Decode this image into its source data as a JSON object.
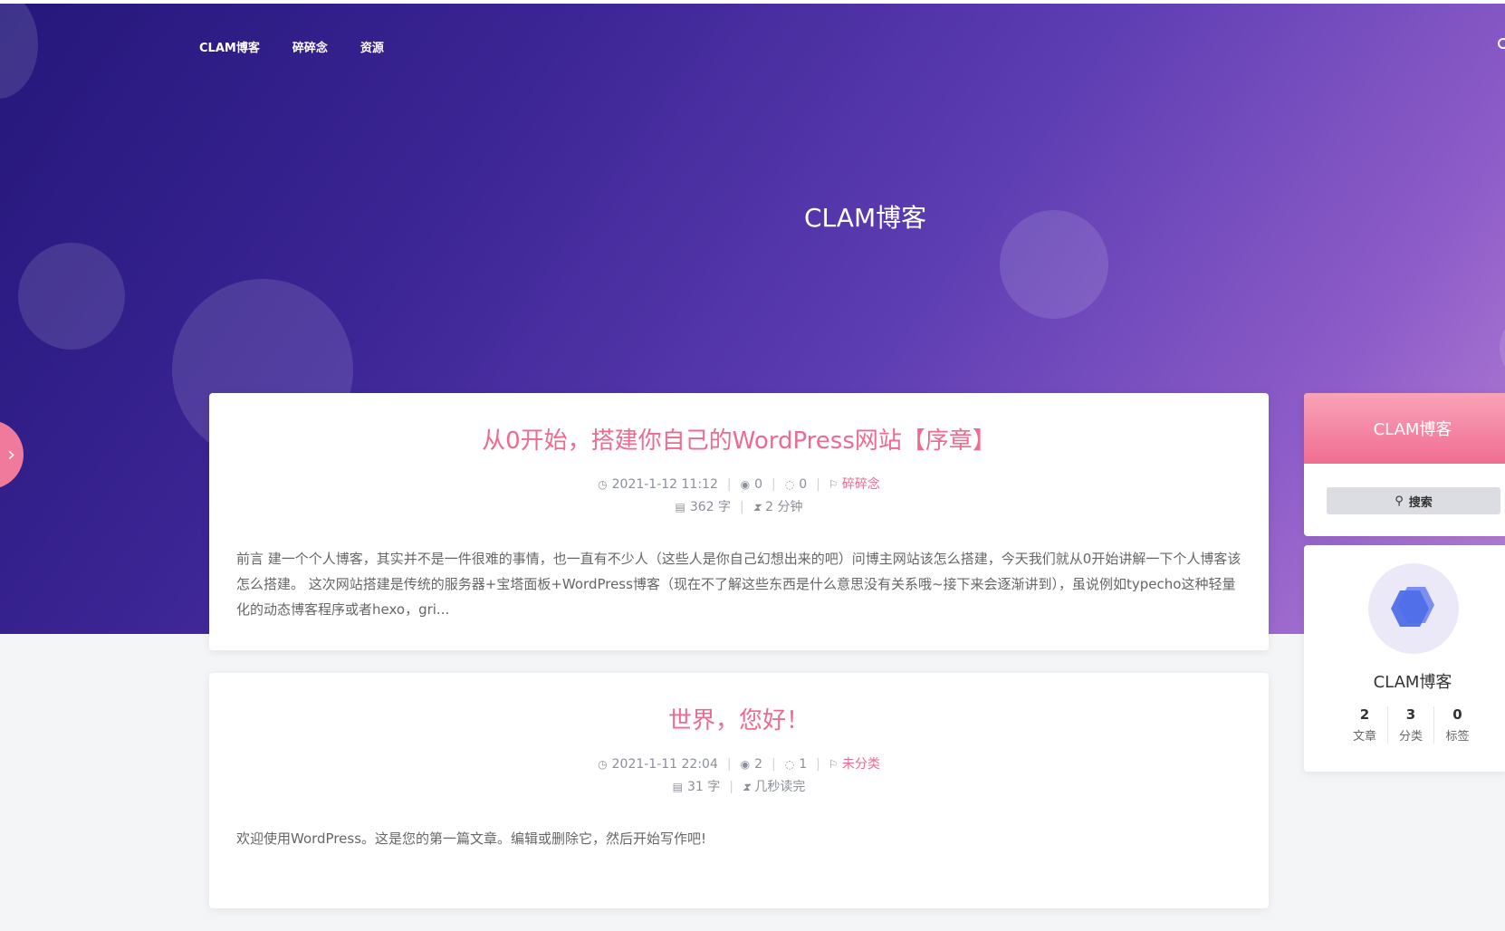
{
  "nav": {
    "items": [
      "CLAM博客",
      "碎碎念",
      "资源"
    ]
  },
  "hero": {
    "title": "CLAM博客"
  },
  "posts": [
    {
      "title": "从0开始，搭建你自己的WordPress网站【序章】",
      "date": "2021-1-12 11:12",
      "views": "0",
      "comments": "0",
      "category": "碎碎念",
      "words": "362 字",
      "read_time": "2 分钟",
      "excerpt": "前言 建一个个人博客，其实并不是一件很难的事情，也一直有不少人（这些人是你自己幻想出来的吧）问博主网站该怎么搭建，今天我们就从0开始讲解一下个人博客该怎么搭建。 这次网站搭建是传统的服务器+宝塔面板+WordPress博客（现在不了解这些东西是什么意思没有关系哦~接下来会逐渐讲到），虽说例如typecho这种轻量化的动态博客程序或者hexo，gri..."
    },
    {
      "title": "世界，您好！",
      "date": "2021-1-11 22:04",
      "views": "2",
      "comments": "1",
      "category": "未分类",
      "words": "31 字",
      "read_time": "几秒读完",
      "excerpt": "欢迎使用WordPress。这是您的第一篇文章。编辑或删除它，然后开始写作吧!"
    }
  ],
  "sidebar": {
    "search_title": "CLAM博客",
    "search_button": "搜索",
    "profile_name": "CLAM博客",
    "stats": [
      {
        "num": "2",
        "label": "文章"
      },
      {
        "num": "3",
        "label": "分类"
      },
      {
        "num": "0",
        "label": "标签"
      }
    ]
  },
  "colors": {
    "accent": "#ee6b8f",
    "hero_start": "#24177a",
    "hero_end": "#b982d6"
  }
}
